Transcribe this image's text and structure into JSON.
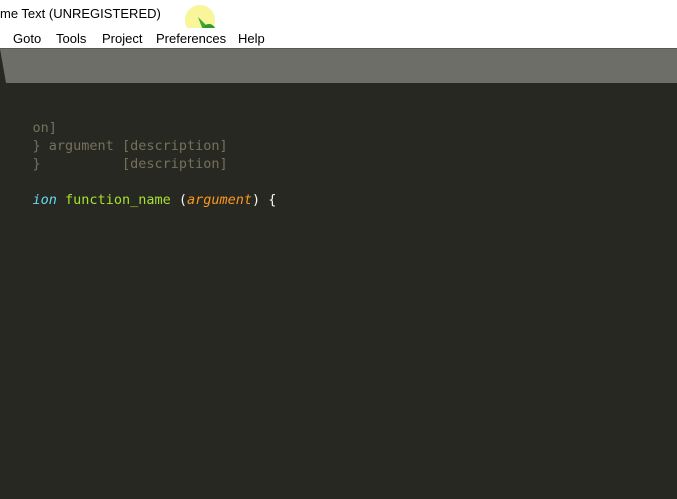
{
  "window": {
    "title": "me Text (UNREGISTERED)"
  },
  "menu": {
    "items": [
      "Goto",
      "Tools",
      "Project",
      "Preferences",
      "Help"
    ]
  },
  "editor": {
    "line1": "on]",
    "line2": {
      "brace": "}",
      "param": " argument",
      "desc": " [description]"
    },
    "line3": {
      "brace": "}",
      "spacer": "          ",
      "desc": "[description]"
    },
    "line5": {
      "keyword": "ion",
      "space1": " ",
      "function_name": "function_name",
      "space2": " ",
      "open_paren": "(",
      "argument": "argument",
      "close": ") {"
    }
  },
  "colors": {
    "background": "#272822",
    "comment": "#75715e",
    "keyword": "#66d9ef",
    "function": "#a6e22e",
    "argument": "#fd971f",
    "text": "#f8f8f2",
    "tabstrip": "#6e6e69"
  }
}
